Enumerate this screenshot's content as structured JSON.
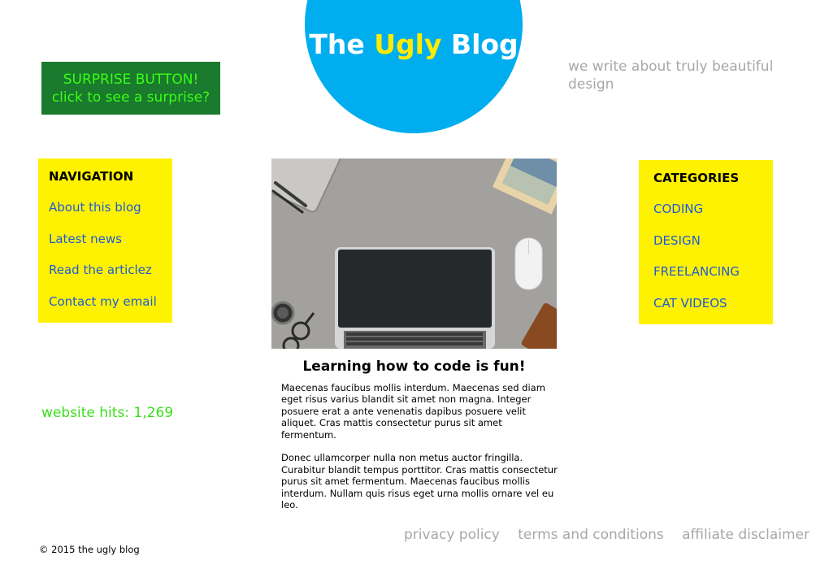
{
  "header": {
    "title_part1": "The ",
    "title_accent": "Ugly",
    "title_part2": " Blog",
    "tagline": "we write about truly beautiful design"
  },
  "surprise_button": {
    "line1": "SURPRISE BUTTON!",
    "line2": "click to see a surprise?"
  },
  "navigation": {
    "heading": "NAVIGATION",
    "items": [
      {
        "label": "About this blog"
      },
      {
        "label": "Latest news"
      },
      {
        "label": "Read the articlez"
      },
      {
        "label": "Contact my email"
      }
    ]
  },
  "categories": {
    "heading": "CATEGORIES",
    "items": [
      {
        "label": "CODING"
      },
      {
        "label": "DESIGN"
      },
      {
        "label": "FREELANCING"
      },
      {
        "label": "CAT VIDEOS"
      }
    ]
  },
  "hits": {
    "label": "website hits: 1,269"
  },
  "article": {
    "title": "Learning how to code is fun!",
    "paragraphs": [
      "Maecenas faucibus mollis interdum. Maecenas sed diam eget risus varius blandit sit amet non magna. Integer posuere erat a ante venenatis dapibus posuere velit aliquet. Cras mattis consectetur purus sit amet fermentum.",
      "Donec ullamcorper nulla non metus auctor fringilla. Curabitur blandit tempus porttitor. Cras mattis consectetur purus sit amet fermentum. Maecenas faucibus mollis interdum. Nullam quis risus eget urna mollis ornare vel eu leo."
    ]
  },
  "footer": {
    "links": [
      "privacy policy",
      "terms and conditions",
      "affiliate disclaimer"
    ],
    "copyright": "© 2015 the ugly blog"
  },
  "colors": {
    "circle_blue": "#00aeef",
    "accent_yellow": "#ffeb00",
    "box_yellow": "#fff200",
    "button_green_bg": "#1a7a2e",
    "button_green_text": "#39ff14",
    "link_blue": "#1f5bd6",
    "muted_gray": "#a7a7a7"
  }
}
